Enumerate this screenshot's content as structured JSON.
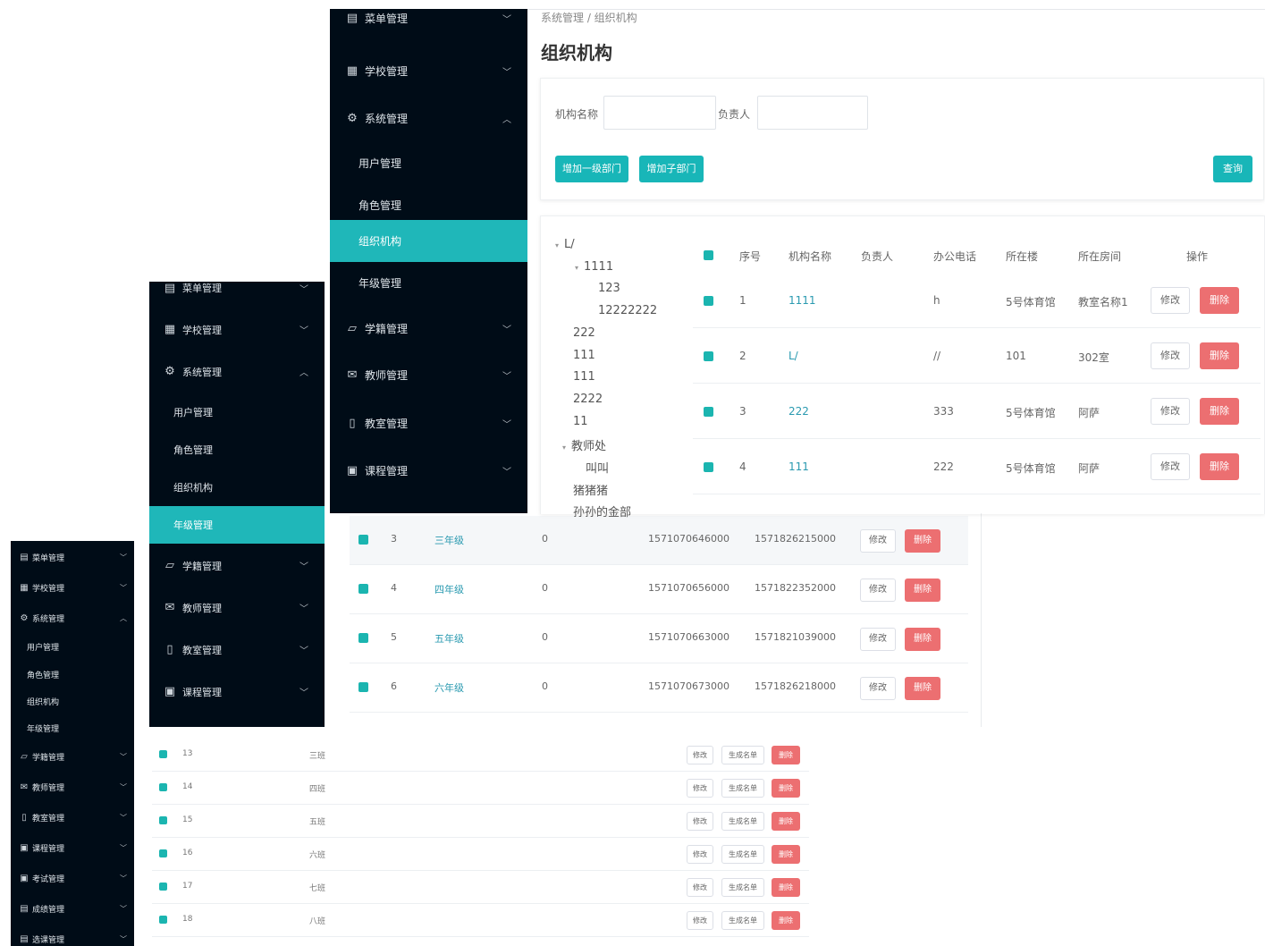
{
  "sidebar_large": {
    "items": [
      {
        "icon": "menu-icon",
        "label": "菜单管理",
        "arrow": "v"
      },
      {
        "icon": "school-icon",
        "label": "学校管理",
        "arrow": "v"
      },
      {
        "icon": "gear-icon",
        "label": "系统管理",
        "arrow": "^"
      },
      {
        "label": "用户管理"
      },
      {
        "label": "角色管理"
      },
      {
        "label": "组织机构",
        "active": true
      },
      {
        "label": "年级管理"
      },
      {
        "icon": "folder-icon",
        "label": "学籍管理",
        "arrow": "v"
      },
      {
        "icon": "mail-icon",
        "label": "教师管理",
        "arrow": "v"
      },
      {
        "icon": "book-icon",
        "label": "教室管理",
        "arrow": "v"
      },
      {
        "icon": "course-icon",
        "label": "课程管理",
        "arrow": "v"
      }
    ]
  },
  "sidebar_mid": {
    "items": [
      {
        "label": "菜单管理"
      },
      {
        "label": "学校管理"
      },
      {
        "label": "系统管理"
      },
      {
        "label": "用户管理"
      },
      {
        "label": "角色管理"
      },
      {
        "label": "组织机构"
      },
      {
        "label": "年级管理",
        "active": true
      },
      {
        "label": "学籍管理"
      },
      {
        "label": "教师管理"
      },
      {
        "label": "教室管理"
      },
      {
        "label": "课程管理"
      }
    ]
  },
  "sidebar_small": {
    "items": [
      {
        "label": "菜单管理"
      },
      {
        "label": "学校管理"
      },
      {
        "label": "系统管理"
      },
      {
        "label": "用户管理"
      },
      {
        "label": "角色管理"
      },
      {
        "label": "组织机构"
      },
      {
        "label": "年级管理"
      },
      {
        "label": "学籍管理"
      },
      {
        "label": "教师管理"
      },
      {
        "label": "教室管理"
      },
      {
        "label": "课程管理"
      },
      {
        "label": "考试管理"
      },
      {
        "label": "成绩管理"
      },
      {
        "label": "选课管理"
      }
    ]
  },
  "org": {
    "breadcrumb": "系统管理 / 组织机构",
    "title": "组织机构",
    "name_label": "机构名称",
    "owner_label": "负责人",
    "add_top_label": "增加一级部门",
    "add_child_label": "增加子部门",
    "query_label": "查询",
    "tree": [
      "L/",
      "1111",
      "123",
      "12222222",
      "222",
      "111",
      "111",
      "2222",
      "11",
      "教师处",
      "叫叫",
      "猪猪猪",
      "孙孙的金部"
    ],
    "headers": [
      "序号",
      "机构名称",
      "负责人",
      "办公电话",
      "所在楼",
      "所在房间",
      "操作"
    ],
    "rows": [
      {
        "no": "1",
        "name": "1111",
        "owner": "",
        "phone": "h",
        "building": "5号体育馆",
        "room": "教室名称1"
      },
      {
        "no": "2",
        "name": "L/",
        "owner": "",
        "phone": "//",
        "building": "101",
        "room": "302室"
      },
      {
        "no": "3",
        "name": "222",
        "owner": "",
        "phone": "333",
        "building": "5号体育馆",
        "room": "阿萨"
      },
      {
        "no": "4",
        "name": "111",
        "owner": "",
        "phone": "222",
        "building": "5号体育馆",
        "room": "阿萨"
      }
    ],
    "edit_label": "修改",
    "delete_label": "删除"
  },
  "grade": {
    "rows": [
      {
        "no": "3",
        "name": "三年级",
        "count": "0",
        "created": "1571070646000",
        "updated": "1571826215000"
      },
      {
        "no": "4",
        "name": "四年级",
        "count": "0",
        "created": "1571070656000",
        "updated": "1571822352000"
      },
      {
        "no": "5",
        "name": "五年级",
        "count": "0",
        "created": "1571070663000",
        "updated": "1571821039000"
      },
      {
        "no": "6",
        "name": "六年级",
        "count": "0",
        "created": "1571070673000",
        "updated": "1571826218000"
      }
    ],
    "edit_label": "修改",
    "delete_label": "删除"
  },
  "classes": {
    "rows": [
      {
        "no": "13",
        "name": "三班"
      },
      {
        "no": "14",
        "name": "四班"
      },
      {
        "no": "15",
        "name": "五班"
      },
      {
        "no": "16",
        "name": "六班"
      },
      {
        "no": "17",
        "name": "七班"
      },
      {
        "no": "18",
        "name": "八班"
      }
    ],
    "edit_label": "修改",
    "gen_label": "生成名单",
    "delete_label": "删除"
  }
}
